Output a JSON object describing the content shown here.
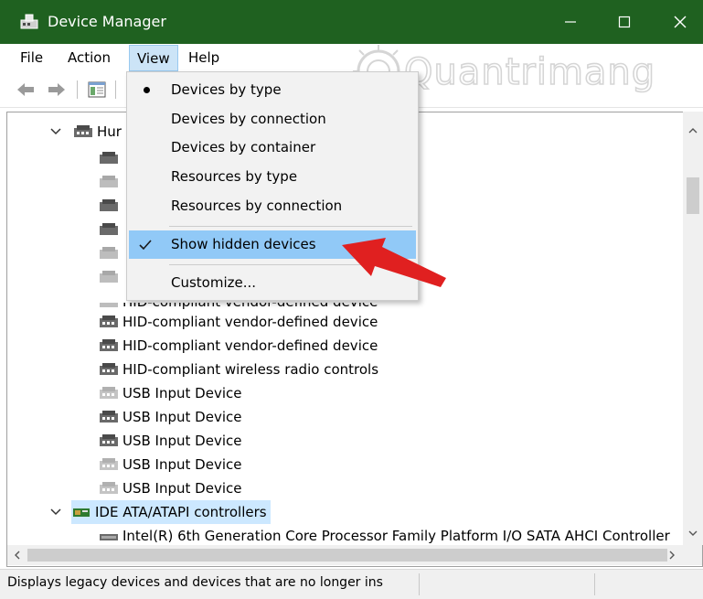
{
  "window": {
    "title": "Device Manager",
    "controls": [
      "minimize",
      "maximize",
      "close"
    ]
  },
  "menubar": {
    "file": "File",
    "action": "Action",
    "view": "View",
    "help": "Help"
  },
  "watermark": "Quantrimang",
  "view_menu": {
    "items": [
      {
        "label": "Devices by type",
        "mark": "bullet"
      },
      {
        "label": "Devices by connection",
        "mark": ""
      },
      {
        "label": "Devices by container",
        "mark": ""
      },
      {
        "label": "Resources by type",
        "mark": ""
      },
      {
        "label": "Resources by connection",
        "mark": ""
      },
      {
        "label": "Show hidden devices",
        "mark": "check"
      },
      {
        "label": "Customize...",
        "mark": ""
      }
    ]
  },
  "tree": {
    "category_partial": "Hur",
    "occluded_row_partial": "HID-compliant vendor-defined device",
    "rows": [
      {
        "label": "HID-compliant vendor-defined device",
        "dimmed": false
      },
      {
        "label": "HID-compliant vendor-defined device",
        "dimmed": false
      },
      {
        "label": "HID-compliant wireless radio controls",
        "dimmed": false
      },
      {
        "label": "USB Input Device",
        "dimmed": true
      },
      {
        "label": "USB Input Device",
        "dimmed": false
      },
      {
        "label": "USB Input Device",
        "dimmed": false
      },
      {
        "label": "USB Input Device",
        "dimmed": true
      },
      {
        "label": "USB Input Device",
        "dimmed": true
      }
    ],
    "category2": "IDE ATA/ATAPI controllers",
    "category2_child": "Intel(R) 6th Generation Core Processor Family Platform I/O SATA AHCI Controller"
  },
  "status": {
    "text": "Displays legacy devices and devices that are no longer ins"
  },
  "colors": {
    "titlebar": "#1f6120",
    "menu_highlight": "#91c9f7",
    "selection": "#cce8ff",
    "arrow": "#e02020"
  }
}
